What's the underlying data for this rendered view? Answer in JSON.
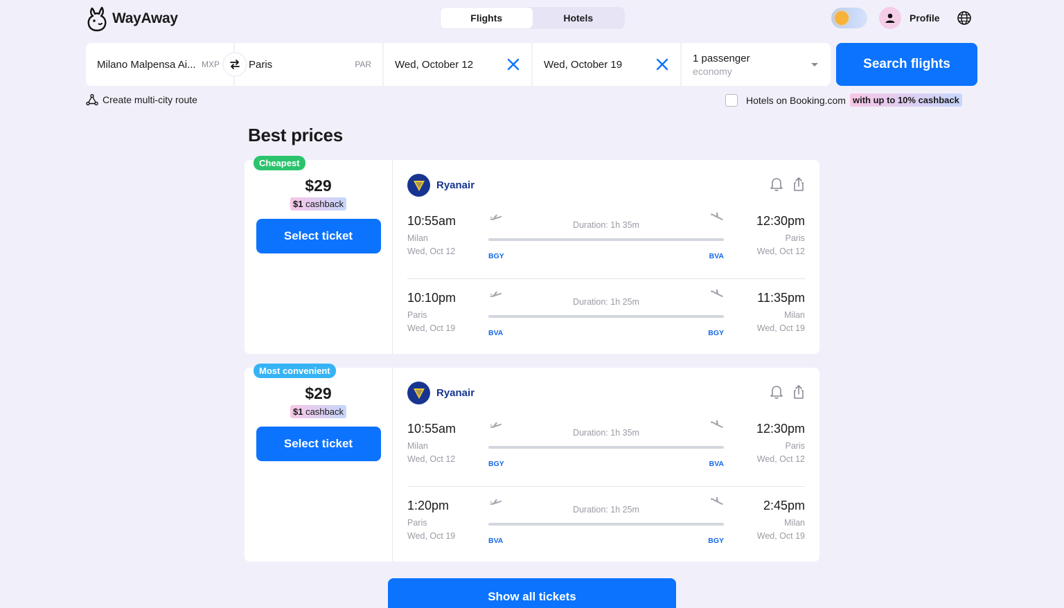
{
  "header": {
    "logo_text": "WayAway",
    "tabs": [
      {
        "label": "Flights",
        "active": true
      },
      {
        "label": "Hotels",
        "active": false
      }
    ],
    "profile_label": "Profile"
  },
  "search": {
    "origin": {
      "value": "Milano Malpensa Ai...",
      "code": "MXP"
    },
    "destination": {
      "value": "Paris",
      "code": "PAR"
    },
    "depart_date": "Wed, October 12",
    "return_date": "Wed, October 19",
    "passengers": "1 passenger",
    "cabin": "economy",
    "button_label": "Search flights"
  },
  "options": {
    "multi_city": "Create multi-city route",
    "hotels_booking": "Hotels on Booking.com",
    "hotels_cashback": "with up to 10% cashback"
  },
  "section_title": "Best prices",
  "tickets": [
    {
      "badge": "Cheapest",
      "price": "$29",
      "cashback_amount": "$1",
      "cashback_label": "cashback",
      "select_label": "Select ticket",
      "airline": "Ryanair",
      "legs": [
        {
          "dep_time": "10:55am",
          "dep_city": "Milan",
          "dep_date": "Wed, Oct 12",
          "dep_code": "BGY",
          "duration": "Duration: 1h 35m",
          "arr_time": "12:30pm",
          "arr_city": "Paris",
          "arr_date": "Wed, Oct 12",
          "arr_code": "BVA"
        },
        {
          "dep_time": "10:10pm",
          "dep_city": "Paris",
          "dep_date": "Wed, Oct 19",
          "dep_code": "BVA",
          "duration": "Duration: 1h 25m",
          "arr_time": "11:35pm",
          "arr_city": "Milan",
          "arr_date": "Wed, Oct 19",
          "arr_code": "BGY"
        }
      ]
    },
    {
      "badge": "Most convenient",
      "price": "$29",
      "cashback_amount": "$1",
      "cashback_label": "cashback",
      "select_label": "Select ticket",
      "airline": "Ryanair",
      "legs": [
        {
          "dep_time": "10:55am",
          "dep_city": "Milan",
          "dep_date": "Wed, Oct 12",
          "dep_code": "BGY",
          "duration": "Duration: 1h 35m",
          "arr_time": "12:30pm",
          "arr_city": "Paris",
          "arr_date": "Wed, Oct 12",
          "arr_code": "BVA"
        },
        {
          "dep_time": "1:20pm",
          "dep_city": "Paris",
          "dep_date": "Wed, Oct 19",
          "dep_code": "BVA",
          "duration": "Duration: 1h 25m",
          "arr_time": "2:45pm",
          "arr_city": "Milan",
          "arr_date": "Wed, Oct 19",
          "arr_code": "BGY"
        }
      ]
    }
  ],
  "show_all_label": "Show all tickets",
  "colors": {
    "primary": "#0c73fe",
    "background": "#f1f0fa",
    "cheapest_badge": "#2bc46d",
    "convenient_badge": "#36b3f5",
    "airline_brand": "#173590"
  }
}
